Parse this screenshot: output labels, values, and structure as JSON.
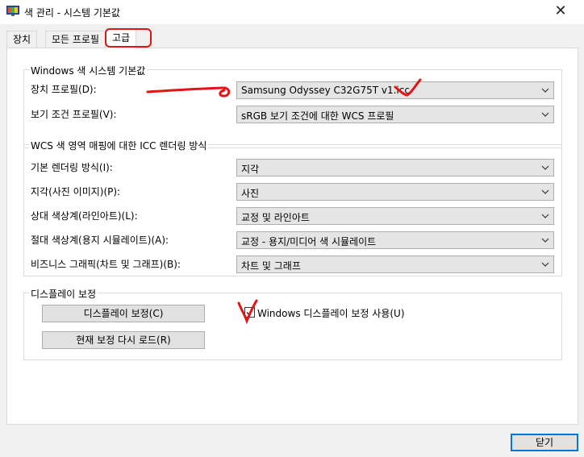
{
  "window": {
    "title": "색 관리 - 시스템 기본값",
    "close_glyph": "✕"
  },
  "tabs": [
    {
      "label": "장치"
    },
    {
      "label": "모든 프로필"
    },
    {
      "label": "고급"
    }
  ],
  "windows_defaults": {
    "title": "Windows 색 시스템 기본값",
    "device_profile_label": "장치 프로필(D):",
    "device_profile_value": "Samsung Odyssey C32G75T v1.icc",
    "viewing_profile_label": "보기 조건 프로필(V):",
    "viewing_profile_value": "sRGB 보기 조건에 대한 WCS 프로필"
  },
  "rendering": {
    "title": "WCS 색 영역 매핑에 대한 ICC 렌더링 방식",
    "rows": [
      {
        "label": "기본 렌더링 방식(I):",
        "value": "지각"
      },
      {
        "label": "지각(사진 이미지)(P):",
        "value": "사진"
      },
      {
        "label": "상대 색상계(라인아트)(L):",
        "value": "교정 및 라인아트"
      },
      {
        "label": "절대 색상계(용지 시뮬레이트)(A):",
        "value": "교정 - 용지/미디어 색 시뮬레이트"
      },
      {
        "label": "비즈니스 그래픽(차트 및 그래프)(B):",
        "value": "차트 및 그래프"
      }
    ]
  },
  "calibration": {
    "title": "디스플레이 보정",
    "calibrate_button": "디스플레이 보정(C)",
    "reload_button": "현재 보정 다시 로드(R)",
    "use_calibration_label": "Windows 디스플레이 보정 사용(U)",
    "use_calibration_checked": true
  },
  "footer": {
    "close_button": "닫기"
  },
  "colors": {
    "annotation_red": "#e31414",
    "panel": "#ffffff",
    "chrome": "#f0f0f0",
    "accent": "#0078d7"
  }
}
